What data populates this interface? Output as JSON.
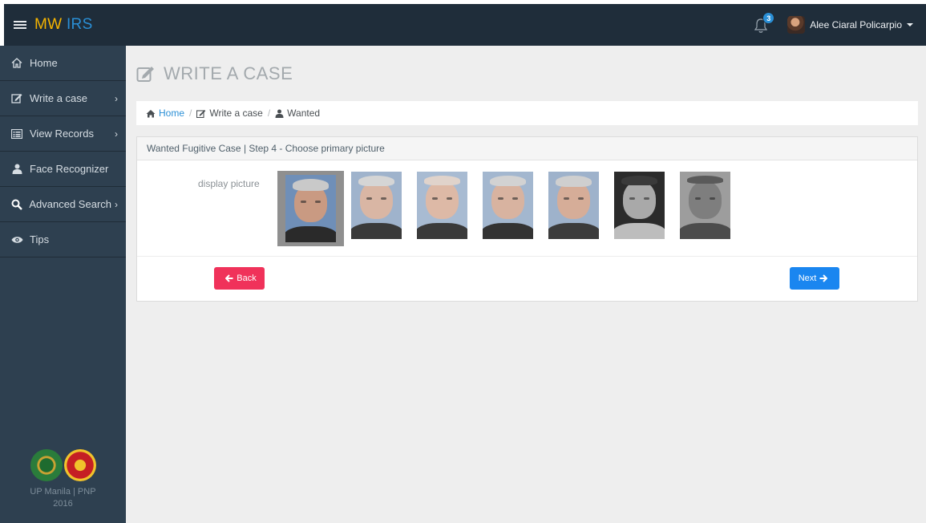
{
  "topbar": {
    "brand_part1": "MW",
    "brand_part2": "IRS",
    "notification_count": "3",
    "user_name": "Alee Ciaral Policarpio"
  },
  "sidebar": {
    "items": [
      {
        "label": "Home",
        "icon": "home-icon",
        "has_submenu": false
      },
      {
        "label": "Write a case",
        "icon": "edit-icon",
        "has_submenu": true
      },
      {
        "label": "View Records",
        "icon": "list-icon",
        "has_submenu": true
      },
      {
        "label": "Face Recognizer",
        "icon": "user-icon",
        "has_submenu": false
      },
      {
        "label": "Advanced Search",
        "icon": "search-icon",
        "has_submenu": true
      },
      {
        "label": "Tips",
        "icon": "eye-icon",
        "has_submenu": false
      }
    ],
    "submenu_chevron": "›",
    "footer_line1": "UP Manila | PNP",
    "footer_line2": "2016"
  },
  "page": {
    "title": "WRITE A CASE"
  },
  "breadcrumb": {
    "home": "Home",
    "separator": "/",
    "write_case": "Write a case",
    "current": "Wanted"
  },
  "panel": {
    "heading": "Wanted Fugitive Case | Step 4 - Choose primary picture",
    "display_picture_label": "display picture",
    "selected_index": 0,
    "photos": [
      {
        "name": "photo-1",
        "tone": "color"
      },
      {
        "name": "photo-2",
        "tone": "faded"
      },
      {
        "name": "photo-3",
        "tone": "faded"
      },
      {
        "name": "photo-4",
        "tone": "faded"
      },
      {
        "name": "photo-5",
        "tone": "faded"
      },
      {
        "name": "photo-6",
        "tone": "grayscale"
      },
      {
        "name": "photo-7",
        "tone": "grayscale"
      }
    ],
    "back_label": "Back",
    "next_label": "Next"
  },
  "colors": {
    "topbar_bg": "#1f2d3a",
    "sidebar_bg": "#2e4050",
    "brand_yellow": "#f5b400",
    "brand_blue": "#2a8fd6",
    "back_button": "#f0325a",
    "next_button": "#1a86f0"
  }
}
